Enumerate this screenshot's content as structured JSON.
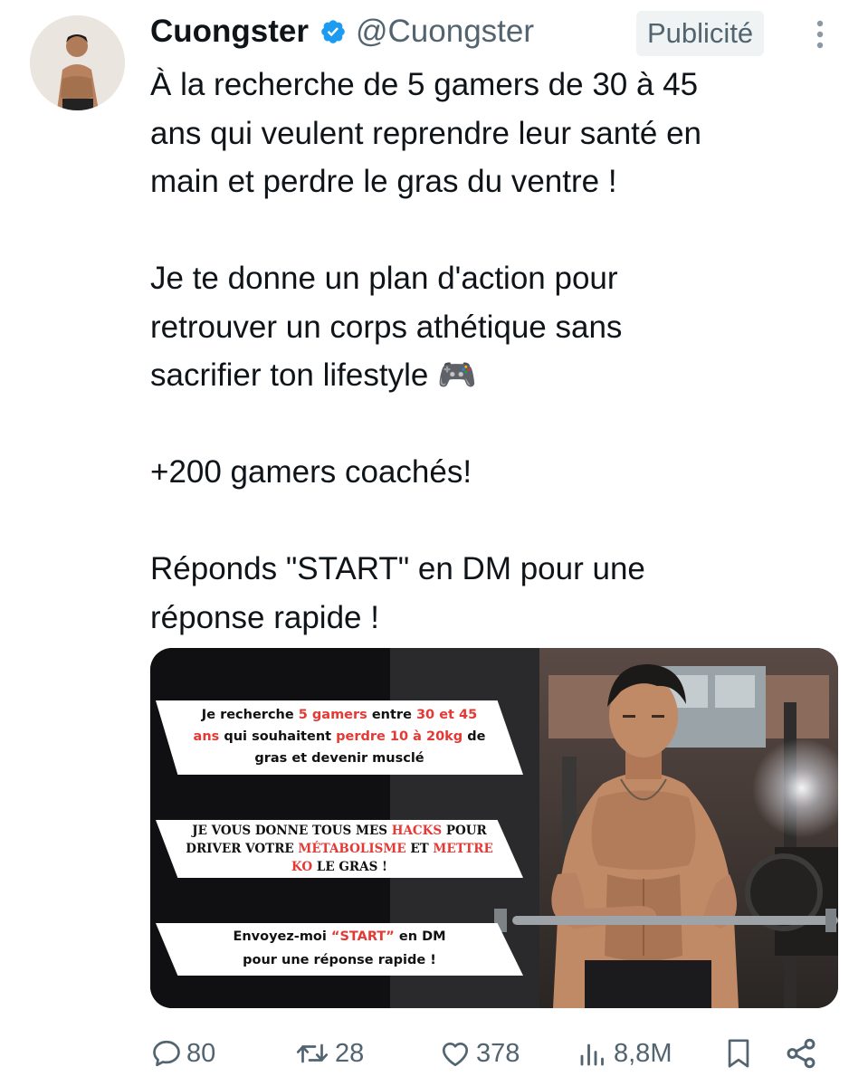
{
  "author": {
    "display_name": "Cuongster",
    "handle": "@Cuongster"
  },
  "ad_label": "Publicité",
  "tweet": {
    "text": "À la recherche de 5 gamers de 30 à 45\nans qui veulent reprendre leur santé en\nmain et perdre le gras du ventre !\n\nJe te donne un plan d'action pour\nretrouver un corps athétique sans\nsacrifier ton lifestyle 🎮\n\n+200 gamers coachés!\n\nRéponds \"START\" en DM pour une\nréponse rapide !"
  },
  "media": {
    "banner1": {
      "line1": [
        "Je recherche ",
        "5 gamers",
        " entre ",
        "30 et 45"
      ],
      "line2": [
        "ans",
        " qui souhaitent ",
        "perdre 10 à 20kg",
        " de"
      ],
      "line3": "gras et devenir musclé"
    },
    "banner2": {
      "line1": [
        "JE VOUS DONNE TOUS MES ",
        "HACKS",
        " POUR"
      ],
      "line2": [
        "DRIVER VOTRE ",
        "MÉTABOLISME",
        " ET ",
        "METTRE"
      ],
      "line3": [
        "KO",
        " LE GRAS !"
      ]
    },
    "banner3": {
      "line1": [
        "Envoyez-moi ",
        "“START”",
        " en DM"
      ],
      "line2": "pour une réponse rapide !"
    }
  },
  "actions": {
    "replies": "80",
    "reposts": "28",
    "likes": "378",
    "views": "8,8M"
  },
  "colors": {
    "accent": "#1d9bf0",
    "muted": "#536471",
    "highlight_red": "#e53935"
  }
}
